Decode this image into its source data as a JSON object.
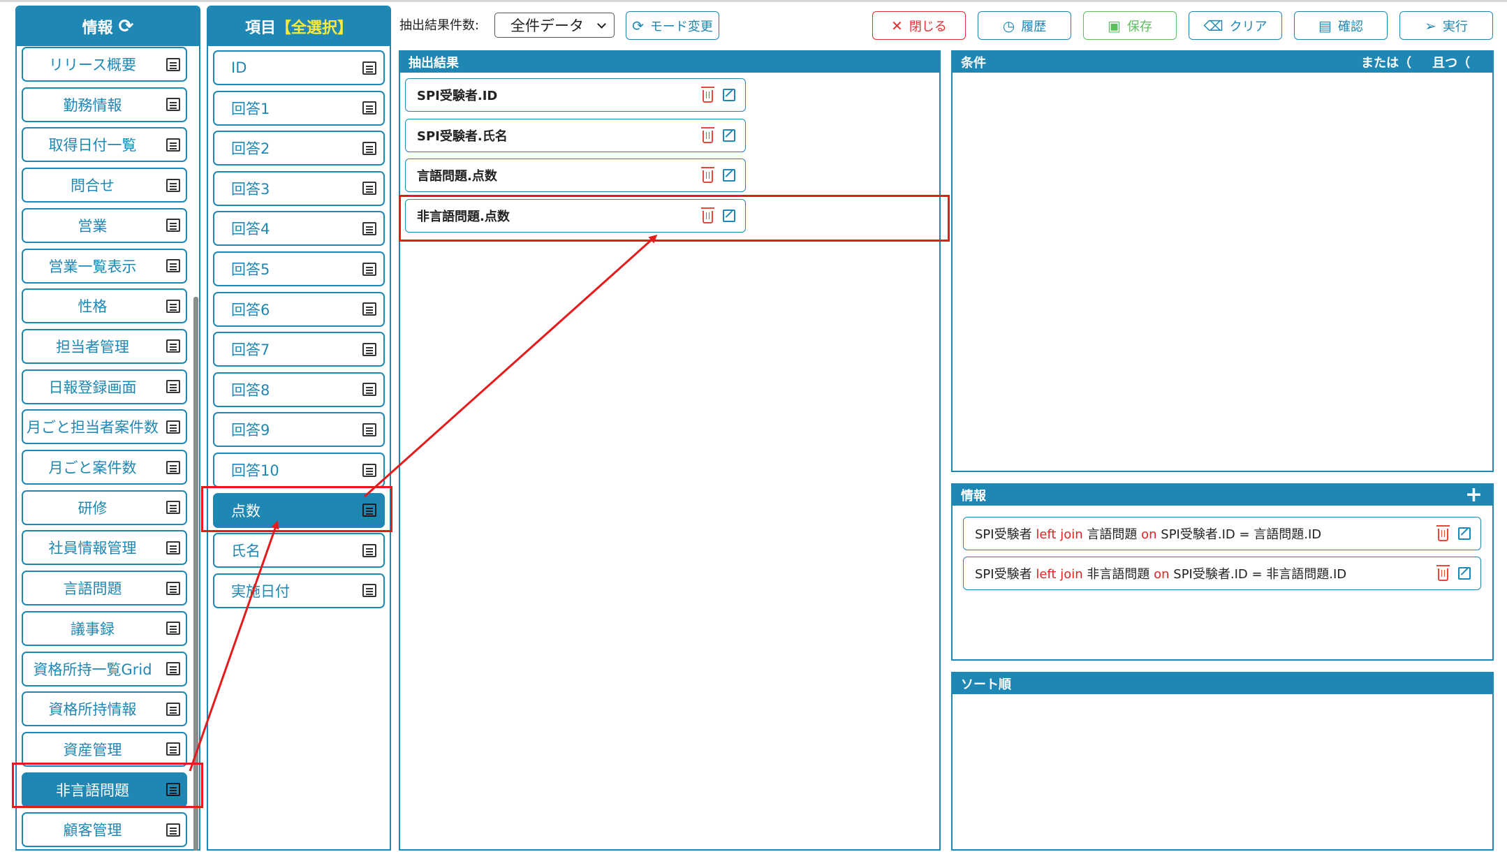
{
  "tables_panel": {
    "title": "情報",
    "items": [
      {
        "label": "リリース概要",
        "selected": false
      },
      {
        "label": "勤務情報",
        "selected": false
      },
      {
        "label": "取得日付一覧",
        "selected": false
      },
      {
        "label": "問合せ",
        "selected": false
      },
      {
        "label": "営業",
        "selected": false
      },
      {
        "label": "営業一覧表示",
        "selected": false
      },
      {
        "label": "性格",
        "selected": false
      },
      {
        "label": "担当者管理",
        "selected": false
      },
      {
        "label": "日報登録画面",
        "selected": false
      },
      {
        "label": "月ごと担当者案件数",
        "selected": false
      },
      {
        "label": "月ごと案件数",
        "selected": false
      },
      {
        "label": "研修",
        "selected": false
      },
      {
        "label": "社員情報管理",
        "selected": false
      },
      {
        "label": "言語問題",
        "selected": false
      },
      {
        "label": "議事録",
        "selected": false
      },
      {
        "label": "資格所持一覧Grid",
        "selected": false
      },
      {
        "label": "資格所持情報",
        "selected": false
      },
      {
        "label": "資産管理",
        "selected": false
      },
      {
        "label": "非言語問題",
        "selected": true
      },
      {
        "label": "顧客管理",
        "selected": false
      }
    ]
  },
  "fields_panel": {
    "title": "項目",
    "select_all": "【全選択】",
    "items": [
      {
        "label": "ID",
        "selected": false
      },
      {
        "label": "回答1",
        "selected": false
      },
      {
        "label": "回答2",
        "selected": false
      },
      {
        "label": "回答3",
        "selected": false
      },
      {
        "label": "回答4",
        "selected": false
      },
      {
        "label": "回答5",
        "selected": false
      },
      {
        "label": "回答6",
        "selected": false
      },
      {
        "label": "回答7",
        "selected": false
      },
      {
        "label": "回答8",
        "selected": false
      },
      {
        "label": "回答9",
        "selected": false
      },
      {
        "label": "回答10",
        "selected": false
      },
      {
        "label": "点数",
        "selected": true
      },
      {
        "label": "氏名",
        "selected": false
      },
      {
        "label": "実施日付",
        "selected": false
      }
    ]
  },
  "toolbar": {
    "count_label": "抽出結果件数:",
    "count_select": "全件データ",
    "mode_change": "モード変更",
    "close": "閉じる",
    "history": "履歴",
    "save": "保存",
    "clear": "クリア",
    "confirm": "確認",
    "execute": "実行"
  },
  "results_panel": {
    "title": "抽出結果",
    "rows": [
      "SPI受験者.ID",
      "SPI受験者.氏名",
      "言語問題.点数",
      "非言語問題.点数"
    ]
  },
  "conditions_panel": {
    "title": "条件",
    "or_label": "または（",
    "and_label": "且つ（"
  },
  "info_panel": {
    "title": "情報",
    "add_symbol": "+",
    "joins": [
      {
        "left": "SPI受験者",
        "join": "left join",
        "table": "言語問題",
        "on": "on",
        "condition": "SPI受験者.ID = 言語問題.ID"
      },
      {
        "left": "SPI受験者",
        "join": "left join",
        "table": "非言語問題",
        "on": "on",
        "condition": "SPI受験者.ID = 非言語問題.ID"
      }
    ]
  },
  "sort_panel": {
    "title": "ソート順"
  },
  "colors": {
    "primary": "#1e87b4",
    "danger": "#e03030",
    "success": "#5cbf5c",
    "highlight": "#e51b1b",
    "select_all": "#ffe93b"
  }
}
